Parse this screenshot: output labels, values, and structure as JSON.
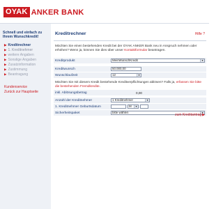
{
  "header": {
    "logo_box": "OYAK",
    "logo_text": "ANKER BANK",
    "brand_color": "#cc1b22",
    "navy_color": "#1f3f78"
  },
  "sidebar": {
    "tagline": "Schnell und einfach zu Ihrem Wunschkredit!",
    "items": [
      {
        "label": "Kreditrechner",
        "state": "active"
      },
      {
        "label": "1. Kreditnehmer",
        "state": "normal"
      },
      {
        "label": "weitere Angaben",
        "state": "muted"
      },
      {
        "label": "Sonstige Angaben",
        "state": "muted"
      },
      {
        "label": "Zusatzinformation",
        "state": "muted"
      },
      {
        "label": "Zustimmung",
        "state": "muted"
      },
      {
        "label": "Beantragung",
        "state": "muted"
      }
    ],
    "links": [
      "Kundenservice",
      "Zurück zur Hauptseite"
    ]
  },
  "main": {
    "title": "Kreditrechner",
    "help": "Hilfe ?",
    "intro": "Möchten Sie einen bestehenden Kredit bei der OYAK ANKER Bank neu in Anspruch nehmen oder erhöhen? Wenn ja, können Sie dies über unser",
    "intro_link": "Kontaktformular",
    "intro_end": "beantragen.",
    "fields": {
      "kreditprodukt_label": "Kreditprodukt",
      "kreditprodukt_value": "MeinWunschKredit",
      "kreditwunsch_label": "Kreditwunsch",
      "kreditwunsch_value": "50.000,00",
      "wunschlaufzeit_label": "Wunschlaufzeit",
      "wunschlaufzeit_value": "12"
    },
    "ablose_text": "Möchten Sie mit diesem Kredit bestehende Kreditverpflichtungen ablösen? Falls ja,",
    "ablose_link": "erfassen Sie bitte die bestehenden Fremdkredite",
    "ablose_end": ".",
    "fields2": {
      "ablosebetrag_label": "inkl. Ablösungsbetrag",
      "ablosebetrag_value": "0,00",
      "anzahl_label": "Anzahl der Kreditnehmer",
      "anzahl_value": "1 Kreditnehmer",
      "geburt_label": "1. Kreditnehmer Geburtsdatum",
      "geburt_month": "M",
      "sicherheit_label": "Sicherheitspaket",
      "sicherheit_value": "bitte wählen"
    },
    "footer_link": "zum Kreditantrag"
  }
}
